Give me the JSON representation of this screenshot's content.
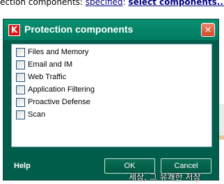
{
  "background": {
    "prefix": "ection components:",
    "link_specified": "specified",
    "link_select": "select components..."
  },
  "dialog": {
    "title": "Protection components",
    "logo_letter": "K",
    "close_glyph": "✕",
    "items": [
      {
        "label": "Files and Memory",
        "checked": false
      },
      {
        "label": "Email and IM",
        "checked": false
      },
      {
        "label": "Web Traffic",
        "checked": false
      },
      {
        "label": "Application Filtering",
        "checked": false
      },
      {
        "label": "Proactive Defense",
        "checked": false
      },
      {
        "label": "Scan",
        "checked": false
      }
    ],
    "help_label": "Help",
    "ok_label": "OK",
    "cancel_label": "Cancel"
  },
  "overlay": {
    "text": "세상, 그 유쾌한 저장"
  },
  "colors": {
    "dialog_bg": "#005e4b",
    "titlebar": "#007b60",
    "link": "#000080",
    "close": "#d1472a"
  }
}
